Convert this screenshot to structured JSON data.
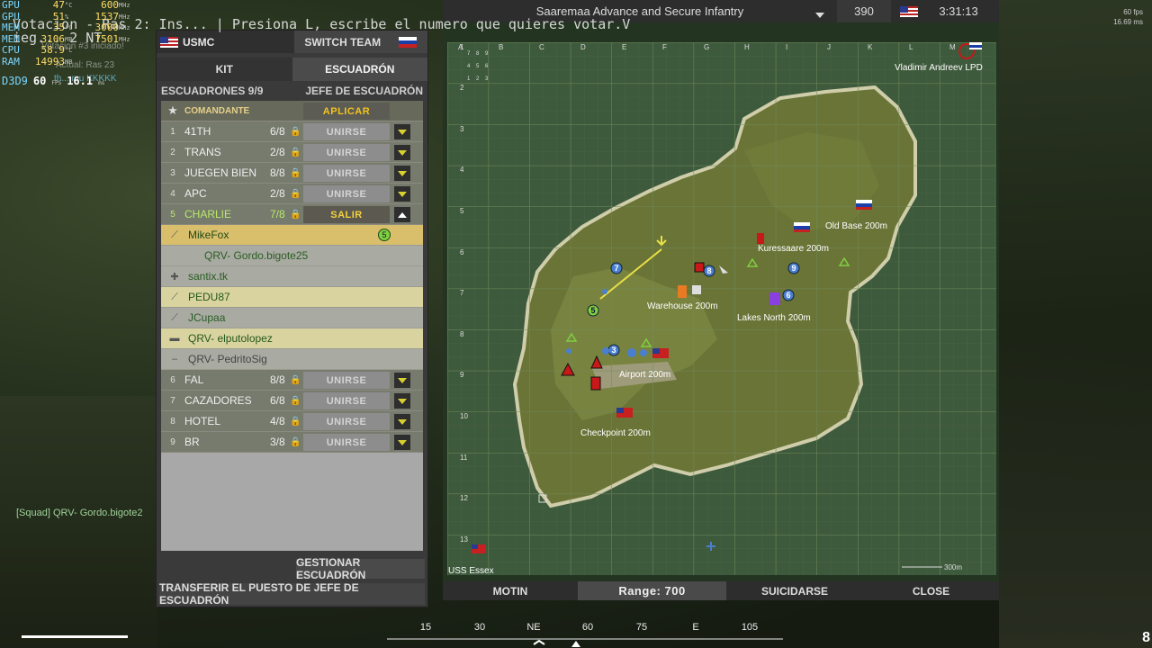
{
  "overlay": {
    "rows": [
      {
        "key": "GPU",
        "v1": "47",
        "u1": "°C",
        "v2": "600",
        "u2": "MHz"
      },
      {
        "key": "GPU",
        "v1": "51",
        "u1": "%",
        "v2": "1537",
        "u2": "MHz"
      },
      {
        "key": "MEM",
        "v1": "35",
        "u1": "°C",
        "v2": "3000",
        "u2": "MHz"
      },
      {
        "key": "MEM",
        "v1": "3106",
        "u1": "MB",
        "v2": "7501",
        "u2": "MHz"
      },
      {
        "key": "CPU",
        "v1": "58.9",
        "u1": "°C",
        "v2": "",
        "u2": ""
      },
      {
        "key": "RAM",
        "v1": "14993",
        "u1": "MB",
        "v2": "",
        "u2": ""
      }
    ],
    "d3d_label": "D3D9",
    "fps_value": "60",
    "fps_unit": "FPS",
    "frametime": "16.1",
    "frametime_unit": "ms"
  },
  "chat_overlay": {
    "line1": "Votacion - Ras 2: Ins... | Presiona L, escribe el numero que quieres votar.V",
    "line2": "ieg... 2 NT",
    "msg_started": "Votacion #3 iniciado!",
    "msg_actual": "Actual: Ras 23",
    "msg_kkk": "th... mu KKKKK"
  },
  "squad_chat": "[Squad] QRV- Gordo.bigote2",
  "fps_corner": {
    "fps": "60 fps",
    "ms": "16.69 ms"
  },
  "panel": {
    "team_name": "USMC",
    "switch_team": "SWITCH TEAM",
    "tab_kit": "KIT",
    "tab_squad": "ESCUADRÓN",
    "squads_header": "ESCUADRONES 9/9",
    "leader_header": "JEFE DE ESCUADRÓN",
    "commander": {
      "label": "COMANDANTE",
      "button": "APLICAR"
    },
    "squads_top": [
      {
        "num": "1",
        "name": "41TH",
        "count": "6/8",
        "button": "UNIRSE"
      },
      {
        "num": "2",
        "name": "TRANS",
        "count": "2/8",
        "button": "UNIRSE"
      },
      {
        "num": "3",
        "name": "JUEGEN BIEN",
        "count": "8/8",
        "button": "UNIRSE"
      },
      {
        "num": "4",
        "name": "APC",
        "count": "2/8",
        "button": "UNIRSE"
      },
      {
        "num": "5",
        "name": "CHARLIE",
        "count": "7/8",
        "button": "SALIR"
      }
    ],
    "members": [
      {
        "name": "MikeFox",
        "badge": "5"
      },
      {
        "name": "QRV- Gordo.bigote25"
      },
      {
        "name": "santix.tk"
      },
      {
        "name": "PEDU87"
      },
      {
        "name": "JCupaa"
      },
      {
        "name": "QRV- elputolopez"
      },
      {
        "name": "QRV- PedritoSig"
      }
    ],
    "squads_bottom": [
      {
        "num": "6",
        "name": "FAL",
        "count": "8/8",
        "button": "UNIRSE"
      },
      {
        "num": "7",
        "name": "CAZADORES",
        "count": "6/8",
        "button": "UNIRSE"
      },
      {
        "num": "8",
        "name": "HOTEL",
        "count": "4/8",
        "button": "UNIRSE"
      },
      {
        "num": "9",
        "name": "BR",
        "count": "3/8",
        "button": "UNIRSE"
      }
    ],
    "manage_button": "GESTIONAR ESCUADRÓN",
    "transfer_button": "TRANSFERIR EL PUESTO DE JEFE DE ESCUADRÓN"
  },
  "map": {
    "layer_name": "Saaremaa Advance and Secure Infantry",
    "tickets": "390",
    "time": "3:31:13",
    "commander_name": "Vladimir Andreev LPD",
    "col_labels": [
      "A",
      "B",
      "C",
      "D",
      "E",
      "F",
      "G",
      "H",
      "I",
      "J",
      "K",
      "L",
      "M"
    ],
    "row_labels": [
      "1",
      "2",
      "3",
      "4",
      "5",
      "6",
      "7",
      "8",
      "9",
      "10",
      "11",
      "12",
      "13"
    ],
    "keypad": [
      "7",
      "8",
      "9",
      "4",
      "5",
      "6",
      "1",
      "2",
      "3"
    ],
    "flags": {
      "old_base": "Old Base 200m",
      "kuressaare": "Kuressaare 200m",
      "warehouse": "Warehouse 200m",
      "lakes_north": "Lakes North 200m",
      "airport": "Airport 200m",
      "checkpoint": "Checkpoint 200m",
      "uss_essex": "USS Essex"
    },
    "squad_markers": [
      "7",
      "8",
      "9",
      "6",
      "5",
      "3"
    ],
    "scale_label": "300m",
    "buttons": {
      "motin": "MOTIN",
      "range": "Range: 700",
      "suicide": "SUICIDARSE",
      "close": "CLOSE"
    }
  },
  "compass": {
    "ticks": [
      "15",
      "30",
      "NE",
      "60",
      "75",
      "E",
      "105"
    ]
  },
  "ammo": "8",
  "colors": {
    "blufor": "#4a7fd0",
    "opfor": "#c81818",
    "squad_green": "#7fd040",
    "panel_yellow": "#f4c41c"
  }
}
